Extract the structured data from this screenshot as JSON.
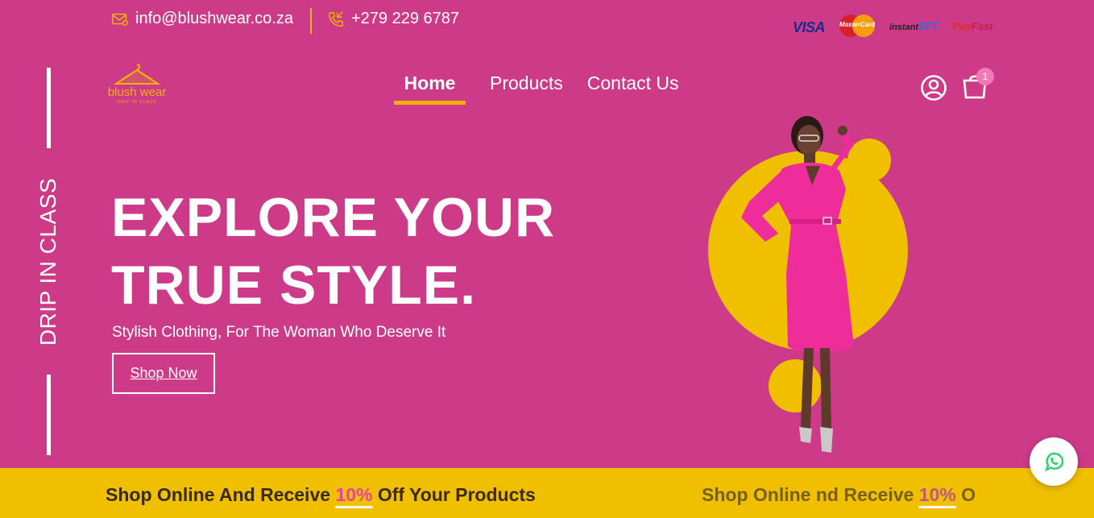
{
  "topbar": {
    "email": "info@blushwear.co.za",
    "phone": "+279 229 6787",
    "payments": {
      "visa": "VISA",
      "mastercard": "MasterCard",
      "instanteft_a": "instant",
      "instanteft_b": "EFT",
      "payfast_a": "Pay",
      "payfast_b": "Fast"
    }
  },
  "brand": {
    "logo_text": "blush wear",
    "logo_sub": "DRIP IN CLASS"
  },
  "nav": {
    "home": "Home",
    "products": "Products",
    "contact": "Contact Us",
    "cart_count": "1"
  },
  "side": {
    "vertical_text": "DRIP IN CLASS"
  },
  "hero": {
    "title_line1": "EXPLORE YOUR",
    "title_line2": "TRUE STYLE.",
    "subtitle": "Stylish Clothing, For The Woman Who Deserve It",
    "cta": "Shop Now"
  },
  "banner": {
    "text_a": "Shop Online And Receive ",
    "percent": "10%",
    "text_b": " Off Your Products",
    "text2_a": "Shop Online ",
    "text2_b": "nd Receive ",
    "text2_c": " O"
  },
  "colors": {
    "background": "#cc3a88",
    "accent": "#f0bf00",
    "button_border": "#ffffff"
  },
  "icons": [
    "email-icon",
    "phone-icon",
    "user-icon",
    "cart-icon",
    "whatsapp-icon",
    "hanger-icon"
  ]
}
